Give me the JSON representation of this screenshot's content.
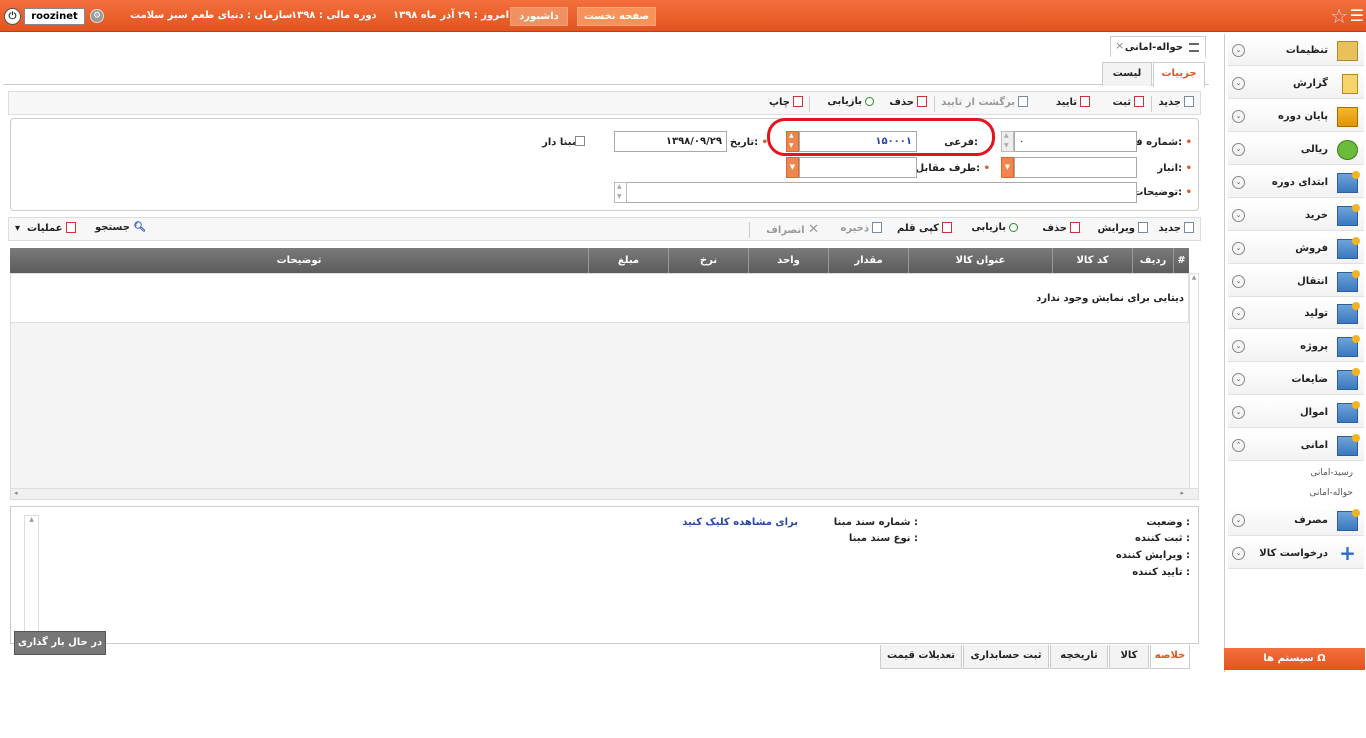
{
  "topbar": {
    "home_label": "صفحه نخست",
    "dashboard_label": "داشبورد",
    "today_label": "امروز : ۲۹ آذر ماه ۱۳۹۸",
    "fiscal_label": "دوره مالی : ۱۳۹۸",
    "org_label": "سازمان : دنیای طعم سبز سلامت",
    "username": "roozinet"
  },
  "sidebar": {
    "items": [
      {
        "label": "تنظیمات"
      },
      {
        "label": "گزارش"
      },
      {
        "label": "پایان دوره"
      },
      {
        "label": "ریالی"
      },
      {
        "label": "ابتدای دوره"
      },
      {
        "label": "خرید"
      },
      {
        "label": "فروش"
      },
      {
        "label": "انتقال"
      },
      {
        "label": "تولید"
      },
      {
        "label": "پروژه"
      },
      {
        "label": "ضایعات"
      },
      {
        "label": "اموال"
      },
      {
        "label": "امانی"
      },
      {
        "label": "مصرف"
      },
      {
        "label": "درخواست کالا"
      }
    ],
    "subitems": [
      "رسید-امانی",
      "حواله-امانی"
    ],
    "system_label": "سیستم ها"
  },
  "document": {
    "tab_title": "حواله-امانی",
    "tabs": [
      "جزییات",
      "لیست"
    ]
  },
  "toolbar": {
    "new": "جدید",
    "save": "ثبت",
    "approve": "تایید",
    "unapprove": "برگشت از تایید",
    "delete": "حذف",
    "refresh": "بازیابی",
    "print": "چاپ"
  },
  "form": {
    "form_number_label": "شماره فرم:",
    "form_number_value": "۰",
    "sub_label": "فرعی:",
    "sub_value": "۱۵۰۰۰۱",
    "date_label": "تاریخ:",
    "date_value": "۱۳۹۸/۰۹/۲۹",
    "based_label": "مبنا دار",
    "warehouse_label": "انبار:",
    "counterparty_label": "طرف مقابل:",
    "description_label": "توضیحات:"
  },
  "item_toolbar": {
    "new": "جدید",
    "edit": "ویرایش",
    "delete": "حذف",
    "refresh": "بازیابی",
    "copy": "کپی قلم",
    "save": "ذخیره",
    "cancel": "انصراف",
    "search": "جستجو",
    "operations": "عملیات"
  },
  "grid": {
    "columns": [
      "#",
      "ردیف",
      "کد کالا",
      "عنوان کالا",
      "مقدار",
      "واحد",
      "نرخ",
      "مبلغ",
      "توضیحات"
    ],
    "empty_text": "دیتایی برای نمایش وجود ندارد"
  },
  "summary": {
    "status_label": "وضعیت :",
    "creator_label": "ثبت کننده :",
    "editor_label": "ویرایش کننده :",
    "approver_label": "تایید کننده :",
    "base_doc_number_label": "شماره سند مبنا :",
    "base_doc_type_label": "نوع سند مبنا :",
    "view_link": "برای مشاهده کلیک کنید"
  },
  "loading_text": "در حال بار گذاری ...",
  "bottom_tabs": [
    "خلاصه",
    "کالا",
    "تاریخچه",
    "ثبت حسابداری",
    "تعدیلات قیمت"
  ]
}
